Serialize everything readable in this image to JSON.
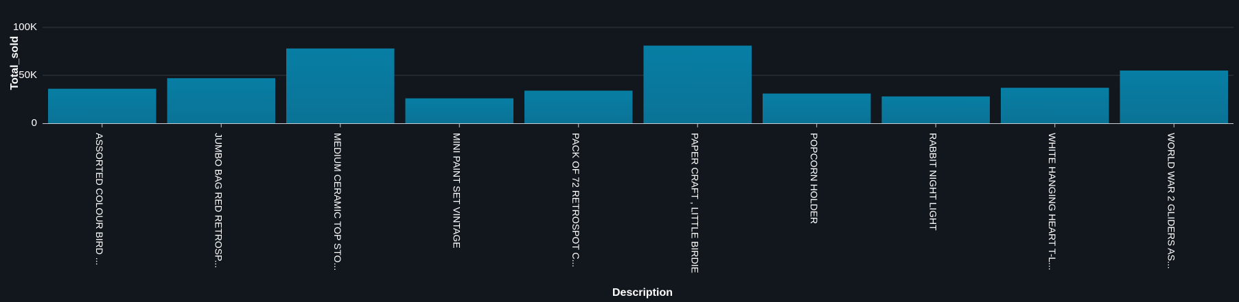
{
  "chart_data": {
    "type": "bar",
    "xlabel": "Description",
    "ylabel": "Total_sold",
    "ylim": [
      0,
      100000
    ],
    "y_ticks": [
      {
        "value": 0,
        "label": "0"
      },
      {
        "value": 50000,
        "label": "50K"
      },
      {
        "value": 100000,
        "label": "100K"
      }
    ],
    "grid": true,
    "categories": [
      "ASSORTED COLOUR BIRD ...",
      "JUMBO BAG RED RETROSP...",
      "MEDIUM CERAMIC TOP STO...",
      "MINI PAINT SET VINTAGE",
      "PACK OF 72 RETROSPOT C...",
      "PAPER CRAFT , LITTLE BIRDIE",
      "POPCORN HOLDER",
      "RABBIT NIGHT LIGHT",
      "WHITE HANGING HEART T-L...",
      "WORLD WAR 2 GLIDERS AS..."
    ],
    "values": [
      36000,
      47000,
      78000,
      26000,
      34000,
      81000,
      31000,
      28000,
      37000,
      55000
    ],
    "colors": {
      "bar_top": "#087ea4",
      "bar_bottom": "#0a7396",
      "background": "#12171d",
      "grid": "#333b3f",
      "axis": "#c9cfd4",
      "text": "#ffffff"
    }
  }
}
